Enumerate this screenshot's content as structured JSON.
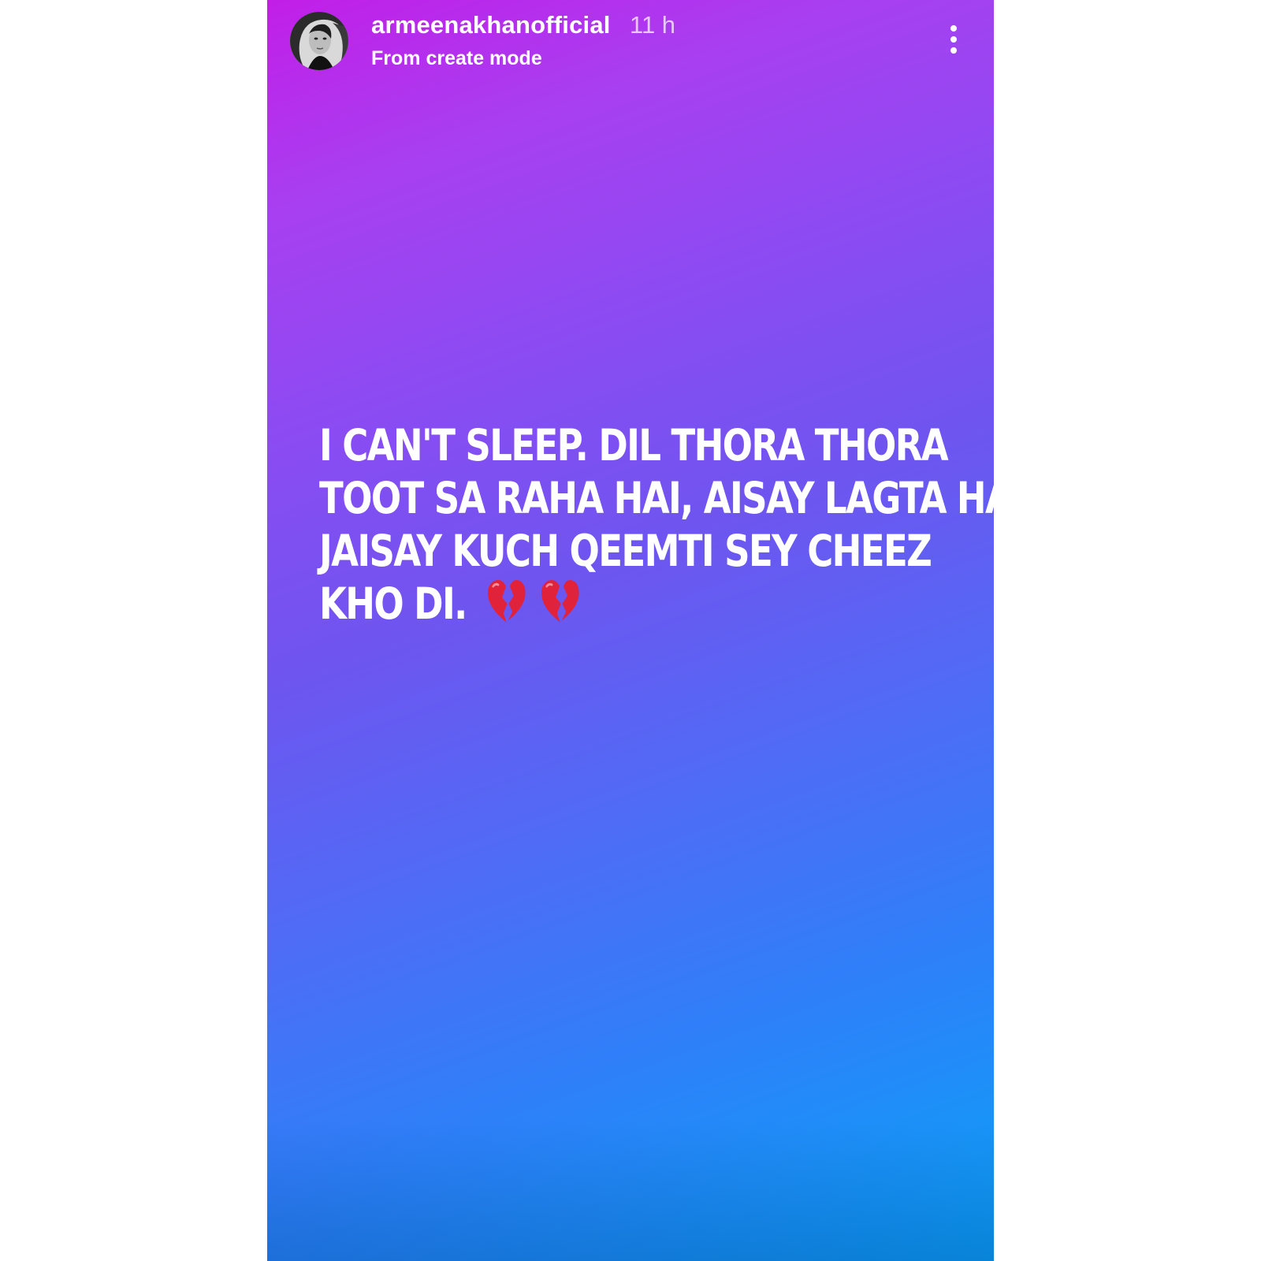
{
  "story": {
    "author": {
      "username": "armeenakhanofficial",
      "time_ago": "11 h",
      "subtitle": "From create mode"
    },
    "text_lines": [
      "I CAN'T SLEEP. DIL THORA THORA",
      "TOOT SA RAHA HAI, AISAY LAGTA HAI",
      "JAISAY KUCH QEEMTI SEY CHEEZ",
      "KHO DI."
    ],
    "emoji": [
      "broken-heart-icon",
      "broken-heart-icon"
    ],
    "colors": {
      "gradient_top": "#c21ee8",
      "gradient_middle": "#6e55f0",
      "gradient_bottom": "#0aa2f8",
      "heart": "#e0223a",
      "text": "#ffffff"
    }
  },
  "icons": {
    "more": "more-vertical-icon",
    "avatar": "profile-avatar"
  }
}
